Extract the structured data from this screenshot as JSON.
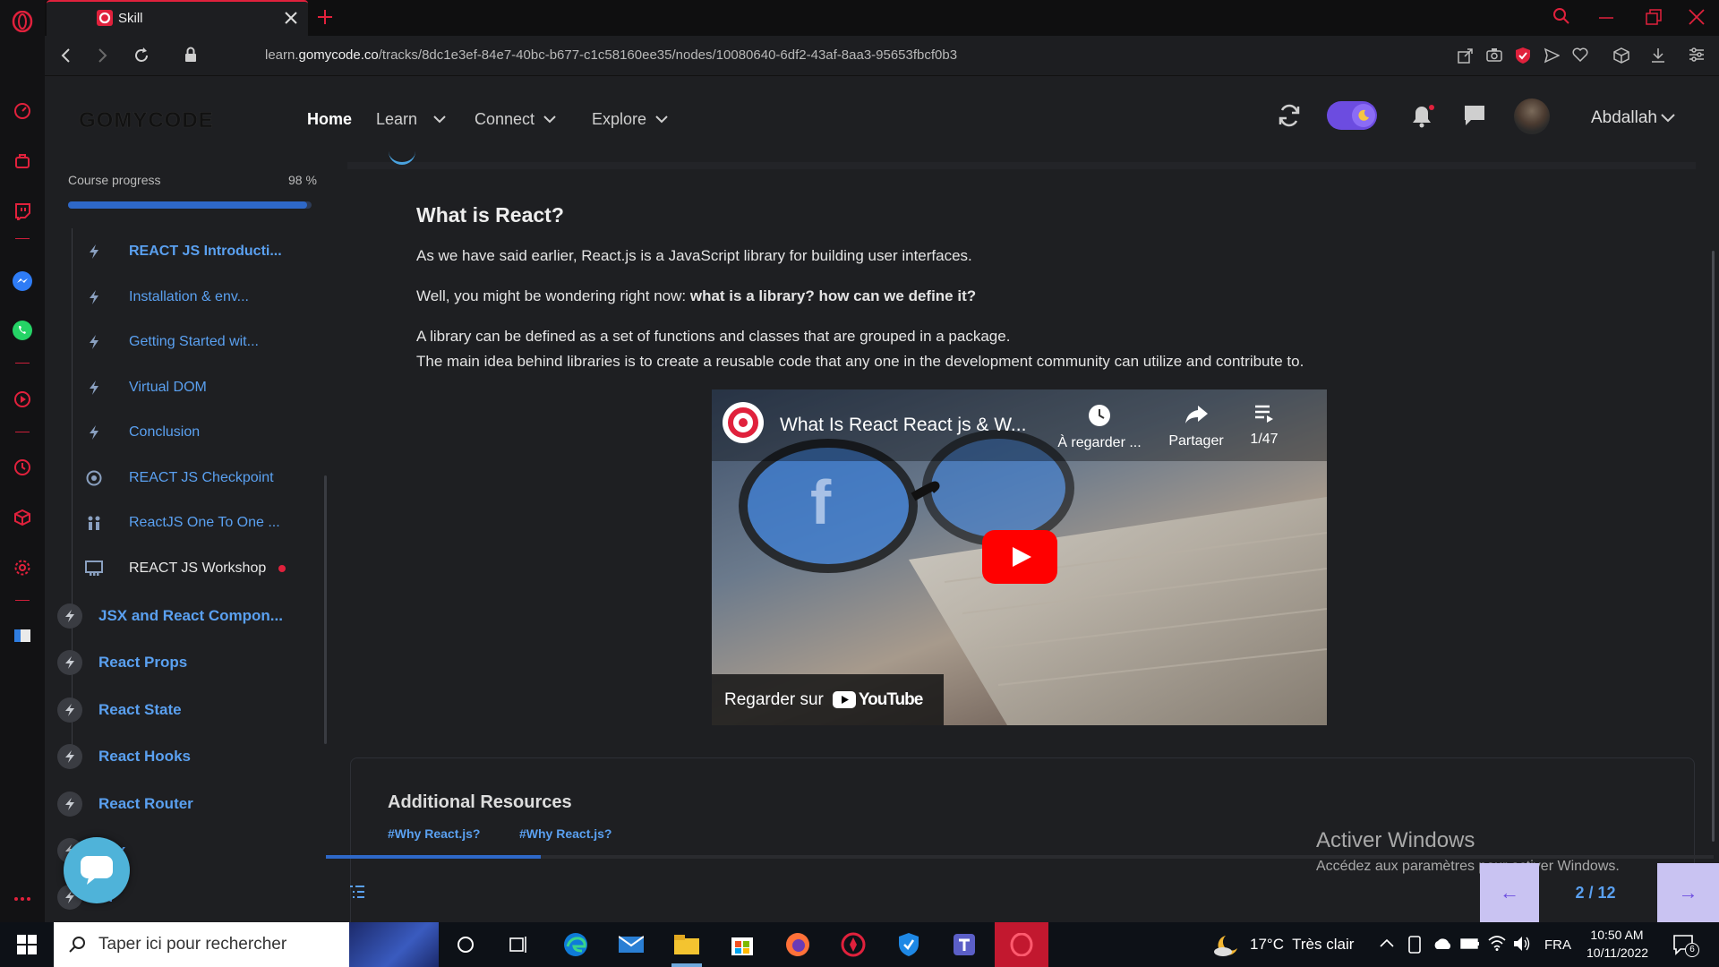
{
  "browser": {
    "tab_title": "Skill",
    "url_prefix": "learn.",
    "url_host": "gomycode.co",
    "url_path": "/tracks/8dc1e3ef-84e7-40bc-b677-c1c58160ee35/nodes/10080640-6df2-43af-8aa3-95653fbcf0b3"
  },
  "header": {
    "logo": "GOMYCODE",
    "nav": {
      "home": "Home",
      "learn": "Learn",
      "connect": "Connect",
      "explore": "Explore"
    },
    "user_name": "Abdallah",
    "colors": {
      "accent": "#6c4ce0",
      "notify": "#e0213c"
    }
  },
  "sidebar": {
    "progress_label": "Course progress",
    "progress_percent": "98 %",
    "progress_value": 0.98,
    "lessons": [
      {
        "label": "REACT JS Introducti...",
        "icon": "bolt-icon"
      },
      {
        "label": "Installation & env...",
        "icon": "bolt-icon"
      },
      {
        "label": "Getting Started wit...",
        "icon": "bolt-icon"
      },
      {
        "label": "Virtual DOM",
        "icon": "bolt-icon"
      },
      {
        "label": "Conclusion",
        "icon": "bolt-icon"
      },
      {
        "label": "REACT JS Checkpoint",
        "icon": "target-icon"
      },
      {
        "label": "ReactJS One To One ...",
        "icon": "people-icon"
      },
      {
        "label": "REACT JS Workshop",
        "icon": "workshop-icon"
      }
    ],
    "chapters": [
      "JSX and React Compon...",
      "React Props",
      "React State",
      "React Hooks",
      "React Router",
      "dux",
      "PI"
    ]
  },
  "article": {
    "heading": "What is React?",
    "p1": "As we have said earlier, React.js is a JavaScript library for building user interfaces.",
    "p2_plain": "Well, you might be wondering right now: ",
    "p2_bold": "what is a library? how can we define it?",
    "p3": "A library can be defined as a set of functions and classes that are grouped in a package.",
    "p4": "The main idea behind libraries is to create a reusable code that any one in the development community can utilize and contribute to."
  },
  "video": {
    "title": "What Is React React js & W...",
    "watch_later": "À regarder ...",
    "share": "Partager",
    "playlist": "1/47",
    "watch_on": "Regarder sur",
    "youtube": "YouTube"
  },
  "resources": {
    "title": "Additional Resources",
    "links": [
      "#Why React.js?",
      "#Why React.js?"
    ]
  },
  "pager": {
    "page": "2 / 12",
    "prev": "←",
    "next": "→"
  },
  "watermark": {
    "title": "Activer Windows",
    "subtitle": "Accédez aux paramètres pour activer Windows."
  },
  "taskbar": {
    "search_placeholder": "Taper ici pour rechercher",
    "weather": "17°C  Très clair",
    "lang": "FRA",
    "time": "10:50 AM",
    "date": "10/11/2022",
    "notif_count": "6"
  }
}
